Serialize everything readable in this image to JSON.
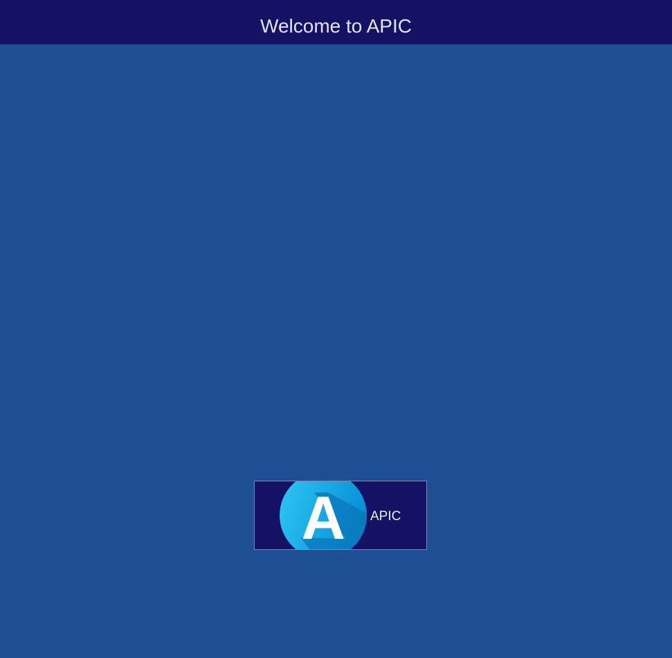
{
  "header": {
    "title": "Welcome to APIC"
  },
  "apps": [
    {
      "label": "APIC",
      "icon": "apic-logo-icon",
      "logo_letter": "A"
    }
  ],
  "colors": {
    "header_bg": "#131265",
    "page_bg": "#1e4f94",
    "tile_bg": "#131265",
    "tile_border": "#7d88b4",
    "text": "#e4e4fb",
    "logo_light": "#2ec7f4",
    "logo_dark": "#0891d8"
  }
}
